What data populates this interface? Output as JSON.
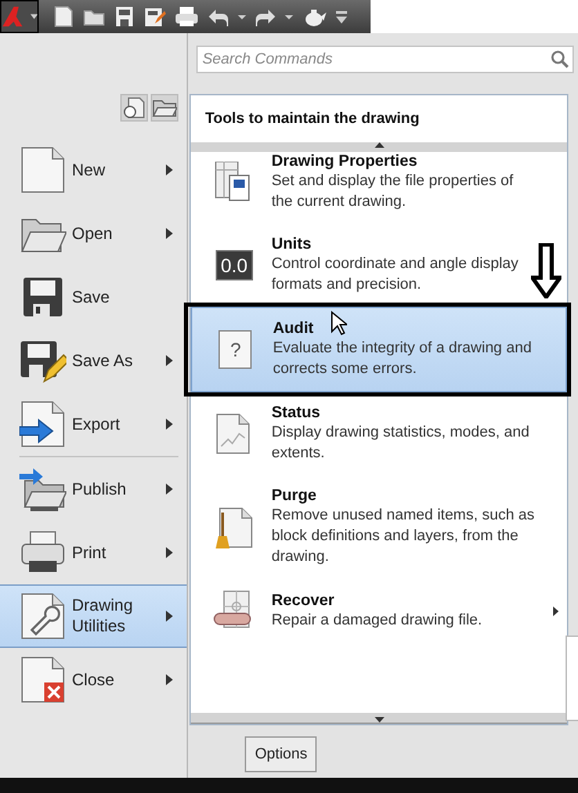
{
  "search": {
    "placeholder": "Search Commands"
  },
  "menu": [
    {
      "label": "New",
      "kind": "new",
      "submenu": true,
      "selected": false
    },
    {
      "label": "Open",
      "kind": "open",
      "submenu": true,
      "selected": false
    },
    {
      "label": "Save",
      "kind": "save",
      "submenu": false,
      "selected": false
    },
    {
      "label": "Save As",
      "kind": "saveas",
      "submenu": true,
      "selected": false
    },
    {
      "label": "Export",
      "kind": "export",
      "submenu": true,
      "selected": false
    },
    {
      "label": "Publish",
      "kind": "publish",
      "submenu": true,
      "selected": false,
      "divider_before": true
    },
    {
      "label": "Print",
      "kind": "print",
      "submenu": true,
      "selected": false
    },
    {
      "label": "Drawing Utilities",
      "kind": "utilities",
      "submenu": true,
      "selected": true
    },
    {
      "label": "Close",
      "kind": "close",
      "submenu": true,
      "selected": false
    }
  ],
  "panel": {
    "title": "Tools to maintain the drawing",
    "items": [
      {
        "title": "Drawing Properties",
        "description": "Set and display the file properties of the current drawing.",
        "kind": "properties",
        "selected": false,
        "submenu": false
      },
      {
        "title": "Units",
        "description": "Control coordinate and angle display formats and precision.",
        "kind": "units",
        "icon_text": "0.0",
        "selected": false,
        "submenu": false
      },
      {
        "title": "Audit",
        "description": "Evaluate the integrity of a drawing and corrects some errors.",
        "kind": "audit",
        "icon_text": "?",
        "selected": true,
        "submenu": false
      },
      {
        "title": "Status",
        "description": "Display drawing statistics, modes, and extents.",
        "kind": "status",
        "selected": false,
        "submenu": false
      },
      {
        "title": "Purge",
        "description": "Remove unused named items, such as block definitions and layers, from the drawing.",
        "kind": "purge",
        "selected": false,
        "submenu": false
      },
      {
        "title": "Recover",
        "description": "Repair a damaged drawing file.",
        "kind": "recover",
        "selected": false,
        "submenu": true
      }
    ]
  },
  "buttons": [
    "Options"
  ]
}
